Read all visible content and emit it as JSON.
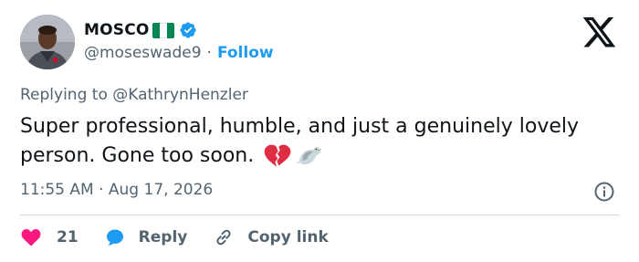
{
  "user": {
    "display_name": "MOSCO",
    "handle": "@moseswade9",
    "separator": "·",
    "follow_label": "Follow",
    "flag_colors": [
      "#008751",
      "#ffffff",
      "#008751"
    ]
  },
  "reply_context": {
    "prefix": "Replying to ",
    "mention": "@KathrynHenzler"
  },
  "tweet": {
    "text": "Super professional, humble, and just a genuinely lovely person. Gone too soon.",
    "emojis": [
      "broken-heart-icon",
      "dove-icon"
    ],
    "timestamp": "11:55 AM · Aug 17, 2026"
  },
  "actions": {
    "like_count": "21",
    "reply_label": "Reply",
    "copy_link_label": "Copy link"
  },
  "colors": {
    "link": "#1d9bf0",
    "secondary_text": "#536471",
    "like": "#f91880",
    "verified": "#1d9bf0"
  }
}
